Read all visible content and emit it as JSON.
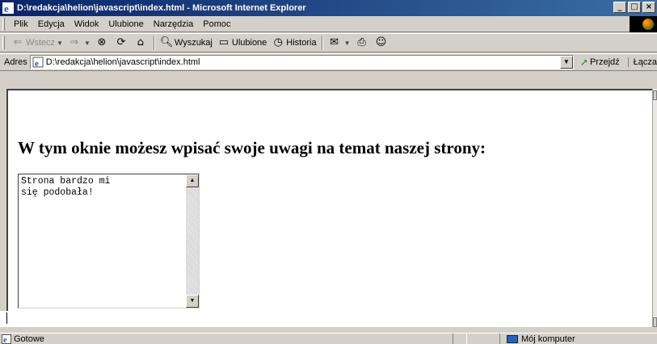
{
  "window": {
    "title": "D:\\redakcja\\helion\\javascript\\index.html - Microsoft Internet Explorer",
    "buttons": [
      "_",
      "□",
      "×"
    ]
  },
  "menu": {
    "items": [
      "Plik",
      "Edycja",
      "Widok",
      "Ulubione",
      "Narzędzia",
      "Pomoc"
    ]
  },
  "toolbar": {
    "back_label": "Wstecz",
    "search_label": "Wyszukaj",
    "favorites_label": "Ulubione",
    "history_label": "Historia",
    "icons": {
      "back": "back-arrow-icon",
      "forward": "forward-arrow-icon",
      "stop": "stop-icon",
      "refresh": "refresh-icon",
      "home": "home-icon",
      "search": "search-icon",
      "favorites": "favorites-folder-icon",
      "history": "history-icon",
      "mail": "mail-icon",
      "print": "print-icon",
      "messenger": "messenger-icon"
    }
  },
  "address": {
    "label": "Adres",
    "value": "D:\\redakcja\\helion\\javascript\\index.html",
    "go_label": "Przejdź",
    "links_label": "Łącza"
  },
  "page": {
    "heading": "W tym oknie możesz wpisać swoje uwagi na temat naszej strony:",
    "textarea_value": "Strona bardzo mi\nsię podobała!"
  },
  "status": {
    "text": "Gotowe",
    "zone": "Mój komputer"
  }
}
